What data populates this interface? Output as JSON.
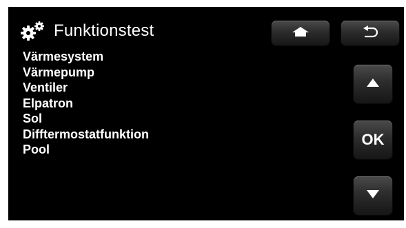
{
  "header": {
    "icon": "gears-icon",
    "title": "Funktionstest"
  },
  "menu": {
    "items": [
      {
        "label": "Värmesystem"
      },
      {
        "label": "Värmepump"
      },
      {
        "label": "Ventiler"
      },
      {
        "label": "Elpatron"
      },
      {
        "label": "Sol"
      },
      {
        "label": "Difftermostatfunktion"
      },
      {
        "label": "Pool"
      }
    ]
  },
  "buttons": {
    "home_icon": "home-icon",
    "back_icon": "back-arrow-icon",
    "up_icon": "up-arrow-icon",
    "ok_label": "OK",
    "down_icon": "down-arrow-icon"
  },
  "colors": {
    "background": "#000000",
    "text": "#ffffff",
    "button_top": "#4a4a4a",
    "button_bottom": "#161616"
  }
}
